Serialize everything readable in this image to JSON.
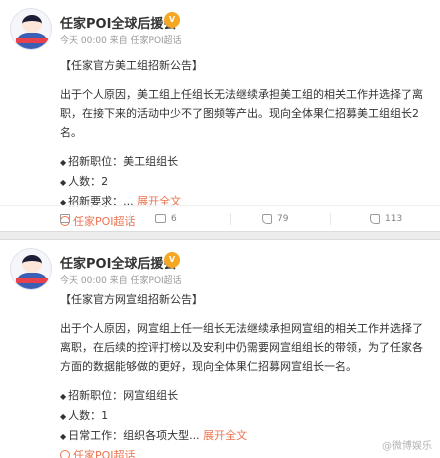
{
  "post1": {
    "author": "任家POI全球后援会",
    "vip_badge": "V",
    "meta": "今天 00:00 来自 任家POI超话",
    "title": "【任家官方美工组招新公告】",
    "body": "出于个人原因，美工组上任组长无法继续承担美工组的相关工作并选择了离职，在接下来的活动中少不了图频等产出。现向全体果仁招募美工组组长2名。",
    "fields": [
      {
        "label": "招新职位：美工组组长"
      },
      {
        "label": "人数：2"
      },
      {
        "label": "招新要求：...",
        "expand": "展开全文"
      }
    ],
    "topic": "任家POI超话",
    "actions": {
      "share": "",
      "comment": "6",
      "like_count": "79",
      "like2": "113"
    }
  },
  "post2": {
    "author": "任家POI全球后援会",
    "vip_badge": "V",
    "meta": "今天 00:00 来自 任家POI超话",
    "title": "【任家官方网宣组招新公告】",
    "body": "出于个人原因，网宣组上任一组长无法继续承担网宣组的相关工作并选择了离职，在后续的控评打榜以及安利中仍需要网宣组组长的带领，为了任家各方面的数据能够做的更好，现向全体果仁招募网宣组长一名。",
    "fields": [
      {
        "label": "招新职位：网宣组组长"
      },
      {
        "label": "人数：1"
      },
      {
        "label": "日常工作：组织各项大型...",
        "expand": "展开全文"
      }
    ],
    "topic": "任家POI超话"
  },
  "watermark": "@微博娱乐"
}
